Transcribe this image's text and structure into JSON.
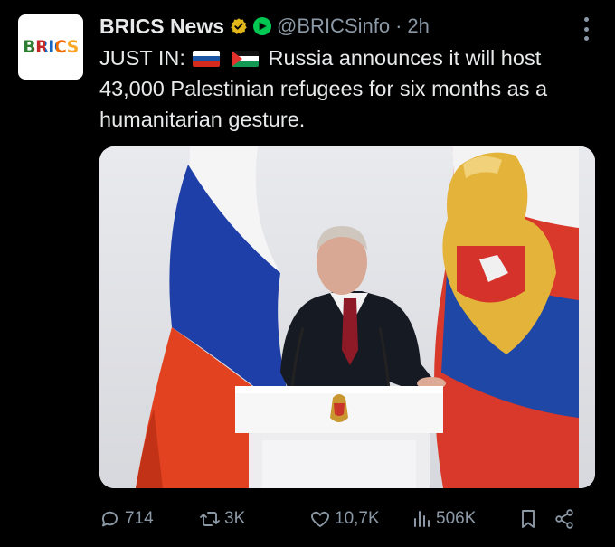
{
  "post": {
    "author_name": "BRICS News",
    "handle": "@BRICSinfo",
    "separator": "·",
    "time": "2h",
    "avatar_text": "BRICS",
    "text_prefix": "JUST IN:",
    "text_body": "Russia announces it will host 43,000 Palestinian refugees for six months as a humanitarian gesture.",
    "flags": [
      "russia-flag",
      "palestine-flag"
    ]
  },
  "actions": {
    "replies": "714",
    "reposts": "3K",
    "likes": "10,7K",
    "views": "506K"
  },
  "colors": {
    "background": "#000000",
    "text": "#e7e9ea",
    "secondary": "#8b98a5",
    "verified_gold": "#e2b719",
    "affiliate_green": "#00c853"
  }
}
